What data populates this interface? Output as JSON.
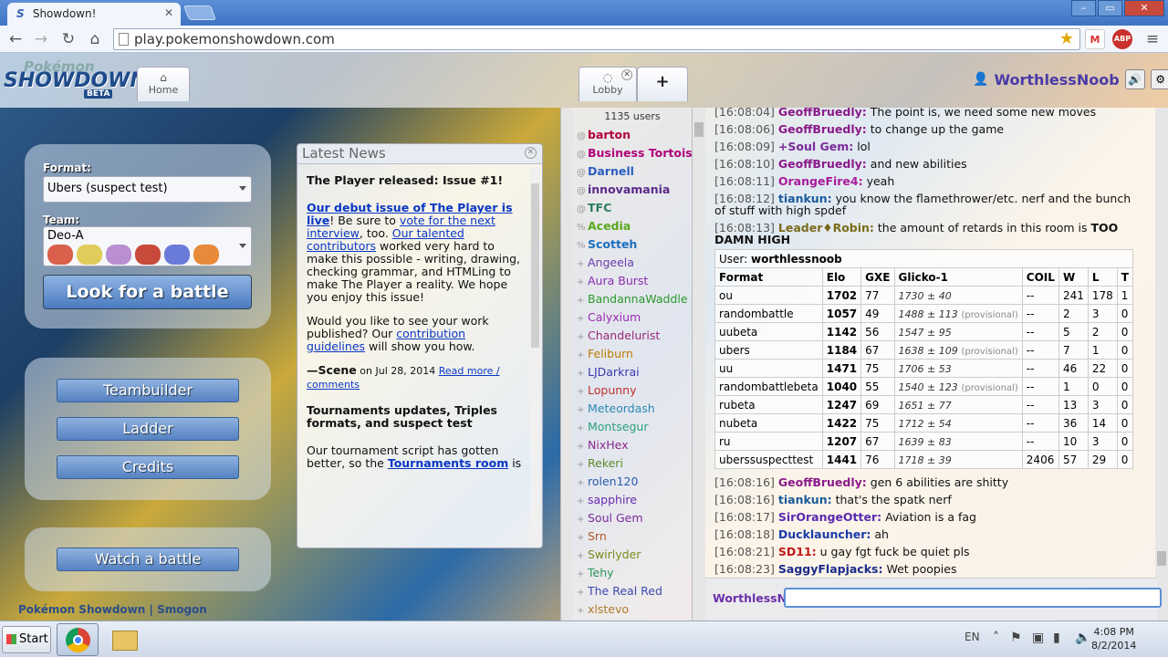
{
  "browser": {
    "tab_title": "Showdown!",
    "tab_close": "✕",
    "url": "play.pokemonshowdown.com",
    "window_buttons": [
      "–",
      "▭",
      "✕"
    ],
    "extensions": {
      "gmail": "M",
      "abp": "ABP"
    }
  },
  "header": {
    "logo_top": "Pokémon",
    "logo_main": "SHOWDOWN",
    "logo_beta": "BETA",
    "tabs": [
      {
        "label": "Home",
        "icon": "home-icon"
      },
      {
        "label": "Lobby",
        "icon": "chat-bubble-icon",
        "close": "✕"
      }
    ],
    "new_tab": "+",
    "username": "WorthlessNoob"
  },
  "home": {
    "format_label": "Format:",
    "format_value": "Ubers (suspect test)",
    "team_label": "Team:",
    "team_value": "Deo-A",
    "search_button": "Look for a battle",
    "nav": [
      "Teambuilder",
      "Ladder",
      "Credits"
    ],
    "watch_button": "Watch a battle",
    "footer": [
      "Pokémon Showdown",
      "|",
      "Smogon"
    ]
  },
  "news": {
    "title": "Latest News",
    "headline1": "The Player released: Issue #1!",
    "p1_link1": "Our debut issue of The Player is live",
    "p1_text1": "! Be sure to ",
    "p1_link2": "vote for the next interview",
    "p1_text2": ", too. ",
    "p1_link3": "Our talented contributors",
    "p1_text3": " worked very hard to make this possible - writing, drawing, checking grammar, and HTMLing to make The Player a reality. We hope you enjoy this issue!",
    "p2_text1": "Would you like to see your work published? Our ",
    "p2_link": "contribution guidelines",
    "p2_text2": " will show you how.",
    "sig_name": "—Scene",
    "sig_date": " on Jul 28, 2014 ",
    "sig_readmore": "Read more / comments",
    "headline2": "Tournaments updates, Triples formats, and suspect test",
    "p3_text1": "Our tournament script has gotten better, so the ",
    "p3_link": "Tournaments room",
    "p3_text2": " is"
  },
  "userlist": {
    "count": "1135 users",
    "users": [
      {
        "g": "@",
        "name": "barton",
        "color": "#b0003a"
      },
      {
        "g": "@",
        "name": "Business Tortoise",
        "color": "#b0007a"
      },
      {
        "g": "@",
        "name": "Darnell",
        "color": "#2a5dbf"
      },
      {
        "g": "@",
        "name": "innovamania",
        "color": "#5a2a8a"
      },
      {
        "g": "@",
        "name": "TFC",
        "color": "#2e7d5a"
      },
      {
        "g": "%",
        "name": "Acedia",
        "color": "#5aa81e"
      },
      {
        "g": "%",
        "name": "Scotteh",
        "color": "#1a6fbf"
      },
      {
        "g": "+",
        "name": "Angeela",
        "color": "#6a3ab0"
      },
      {
        "g": "+",
        "name": "Aura Burst",
        "color": "#8a2ab0"
      },
      {
        "g": "+",
        "name": "BandannaWaddle",
        "color": "#2a9a2a"
      },
      {
        "g": "+",
        "name": "Calyxium",
        "color": "#9a2ab0"
      },
      {
        "g": "+",
        "name": "Chandelurist",
        "color": "#9a2a7a"
      },
      {
        "g": "+",
        "name": "Feliburn",
        "color": "#c07a00"
      },
      {
        "g": "+",
        "name": "LJDarkrai",
        "color": "#3a3ab0"
      },
      {
        "g": "+",
        "name": "Lopunny",
        "color": "#c0302a"
      },
      {
        "g": "+",
        "name": "Meteordash",
        "color": "#2a8ab0"
      },
      {
        "g": "+",
        "name": "Montsegur",
        "color": "#2aa07a"
      },
      {
        "g": "+",
        "name": "NixHex",
        "color": "#8a2a8a"
      },
      {
        "g": "+",
        "name": "Rekeri",
        "color": "#5a8a2a"
      },
      {
        "g": "+",
        "name": "rolen120",
        "color": "#2a5ab0"
      },
      {
        "g": "+",
        "name": "sapphire",
        "color": "#6a2ab0"
      },
      {
        "g": "+",
        "name": "Soul Gem",
        "color": "#7a2a9a"
      },
      {
        "g": "+",
        "name": "Srn",
        "color": "#b05a2a"
      },
      {
        "g": "+",
        "name": "Swirlyder",
        "color": "#7a8a1a"
      },
      {
        "g": "+",
        "name": "Tehy",
        "color": "#2a9a5a"
      },
      {
        "g": "+",
        "name": "The Real Red",
        "color": "#3a4ab0"
      },
      {
        "g": "+",
        "name": "xlstevo",
        "color": "#b07a2a"
      }
    ]
  },
  "chat": {
    "messages_top": [
      {
        "ts": "[16:08:04]",
        "name": "GeoffBruedly:",
        "color": "#8a1a8a",
        "text": "The point is, we need some new moves"
      },
      {
        "ts": "[16:08:06]",
        "name": "GeoffBruedly:",
        "color": "#8a1a8a",
        "text": "to change up the game"
      },
      {
        "ts": "[16:08:09]",
        "name": "+Soul Gem:",
        "color": "#7a2a9a",
        "text": "lol"
      },
      {
        "ts": "[16:08:10]",
        "name": "GeoffBruedly:",
        "color": "#8a1a8a",
        "text": "and new abilities"
      },
      {
        "ts": "[16:08:11]",
        "name": "OrangeFire4:",
        "color": "#a81a9a",
        "text": "yeah"
      },
      {
        "ts": "[16:08:12]",
        "name": "tiankun:",
        "color": "#1a5a9a",
        "text": "you know the flamethrower/etc. nerf and the bunch of stuff with high spdef"
      },
      {
        "ts": "[16:08:13]",
        "name": "Leader♦Robin:",
        "color": "#7a6a1a",
        "text": "the amount of retards in this room is ",
        "bold": "TOO DAMN HIGH"
      }
    ],
    "rank_user_label": "User: ",
    "rank_user": "worthlessnoob",
    "rank_headers": [
      "Format",
      "Elo",
      "GXE",
      "Glicko-1",
      "COIL",
      "W",
      "L",
      "T"
    ],
    "rank_rows": [
      [
        "ou",
        "1702",
        "77",
        "1730 ± 40",
        "",
        "--",
        "241",
        "178",
        "1"
      ],
      [
        "randombattle",
        "1057",
        "49",
        "1488 ± 113",
        "(provisional)",
        "--",
        "2",
        "3",
        "0"
      ],
      [
        "uubeta",
        "1142",
        "56",
        "1547 ± 95",
        "",
        "--",
        "5",
        "2",
        "0"
      ],
      [
        "ubers",
        "1184",
        "67",
        "1638 ± 109",
        "(provisional)",
        "--",
        "7",
        "1",
        "0"
      ],
      [
        "uu",
        "1471",
        "75",
        "1706 ± 53",
        "",
        "--",
        "46",
        "22",
        "0"
      ],
      [
        "randombattlebeta",
        "1040",
        "55",
        "1540 ± 123",
        "(provisional)",
        "--",
        "1",
        "0",
        "0"
      ],
      [
        "rubeta",
        "1247",
        "69",
        "1651 ± 77",
        "",
        "--",
        "13",
        "3",
        "0"
      ],
      [
        "nubeta",
        "1422",
        "75",
        "1712 ± 54",
        "",
        "--",
        "36",
        "14",
        "0"
      ],
      [
        "ru",
        "1207",
        "67",
        "1639 ± 83",
        "",
        "--",
        "10",
        "3",
        "0"
      ],
      [
        "uberssuspecttest",
        "1441",
        "76",
        "1718 ± 39",
        "",
        "2406",
        "57",
        "29",
        "0"
      ]
    ],
    "messages_bottom": [
      {
        "ts": "[16:08:16]",
        "name": "GeoffBruedly:",
        "color": "#8a1a8a",
        "text": "gen 6 abilities are shitty"
      },
      {
        "ts": "[16:08:16]",
        "name": "tiankun:",
        "color": "#1a5a9a",
        "text": "that's the spatk nerf"
      },
      {
        "ts": "[16:08:17]",
        "name": "SirOrangeOtter:",
        "color": "#5a2ab0",
        "text": "Aviation is a fag"
      },
      {
        "ts": "[16:08:18]",
        "name": "Ducklauncher:",
        "color": "#1a3aa8",
        "text": "ah"
      },
      {
        "ts": "[16:08:21]",
        "name": "SD11:",
        "color": "#c01a1a",
        "text": "u gay fgt fuck be quiet pls"
      },
      {
        "ts": "[16:08:23]",
        "name": "SaggyFlapjacks:",
        "color": "#1a2a8a",
        "text": "Wet poopies"
      }
    ],
    "me": "WorthlessN"
  },
  "taskbar": {
    "start": "Start",
    "lang": "EN",
    "time": "4:08 PM",
    "date": "8/2/2014"
  }
}
